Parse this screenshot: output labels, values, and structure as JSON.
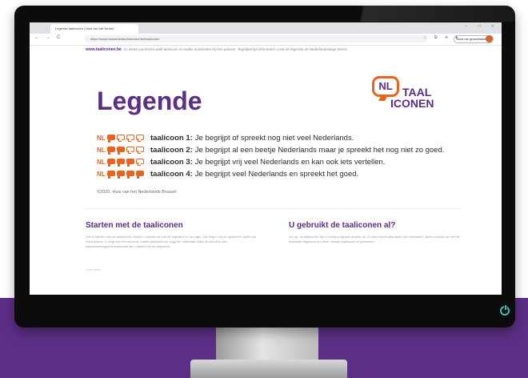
{
  "browser": {
    "tab_title": "Legende taaliconen | Huis van het Nederl...",
    "tab_close": "×",
    "window_controls": "– □ ×",
    "nav_back": "←",
    "nav_forward": "→",
    "nav_reload": "C",
    "url": "https://www.huisnederlandsbrussel.be/taaliconen",
    "extensions": "☆ ⧉ ⊕ ⧫",
    "profile_button": "Nood van geautomatiseerd"
  },
  "page": {
    "intro_link": "www.taaliconen.be",
    "intro_text": ". Zo weten uw lezers welk taalicoon en welke activiteiten bij hen passen. Tegelijkertijd informeert u met de legende de Nederlandstalige lezers.",
    "title": "Legende",
    "logo": {
      "bubble": "NL",
      "word1": "TAAL",
      "word2": "ICONEN"
    },
    "legend": [
      {
        "prefix": "NL",
        "filled": 1,
        "label": "taalicoon 1:",
        "text": "Je begrijpt of spreekt nog niet veel Nederlands."
      },
      {
        "prefix": "NL",
        "filled": 2,
        "label": "taalicoon 2:",
        "text": "Je begrijpt al een beetje Nederlands maar je spreekt het nog niet zo goed."
      },
      {
        "prefix": "NL",
        "filled": 3,
        "label": "taalicoon 3:",
        "text": "Je begrijpt vrij veel Nederlands en kan ook iets vertellen."
      },
      {
        "prefix": "NL",
        "filled": 4,
        "label": "taalicoon 4:",
        "text": "Je begrijpt veel Nederlands en spreekt het goed."
      }
    ],
    "copyright": "©2020, Huis van het Nederlands Brussel",
    "col1": {
      "title": "Starten met de taaliconen",
      "text": "Om te starten met de taaliconen, neemt u contact op met de regisseur in uw regio. Die helpt u bij de opstart en geeft ook extra advies. U volgt een infomoment, maakt afspraken en krijgt het materiaal. Alles zit vervat in een samenwerkingsovereenkomst die u afsluit met de regisseur."
    },
    "col2": {
      "title": "U gebruikt de taaliconen al?",
      "text": "Let op, de taaliconen zijn er sinds vorig jaar anders uit. Zo ook enkele afspraken zijn veranderd. Neem contact op met de regionale regisseur om deze nieuwe taaliconen te gebruiken."
    },
    "more": "Lees meer..."
  },
  "colors": {
    "brand_purple": "#5b2f86",
    "brand_orange": "#e8641e",
    "power_led": "#2ec4c4"
  }
}
